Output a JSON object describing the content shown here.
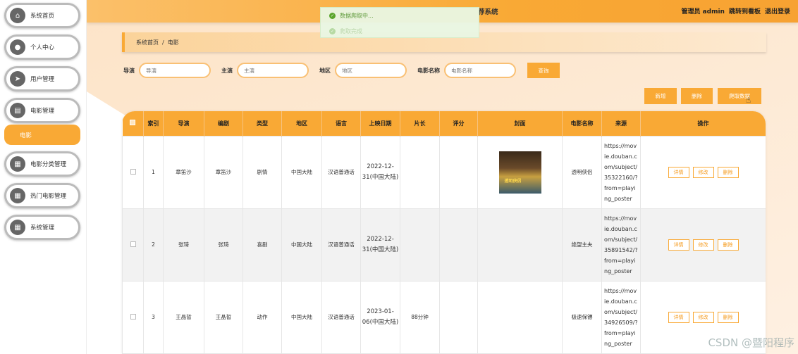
{
  "sidebar": {
    "items": [
      {
        "label": "系统首页",
        "icon": "home-icon"
      },
      {
        "label": "个人中心",
        "icon": "user-icon"
      },
      {
        "label": "用户管理",
        "icon": "send-icon"
      },
      {
        "label": "电影管理",
        "icon": "clipboard-icon"
      },
      {
        "label": "电影分类管理",
        "icon": "grid-icon"
      },
      {
        "label": "热门电影管理",
        "icon": "grid-icon"
      },
      {
        "label": "系统管理",
        "icon": "grid-icon"
      }
    ],
    "sub_item": {
      "label": "电影"
    }
  },
  "header": {
    "title_fragment": "荐系统",
    "admin": "管理员 admin",
    "goto_dashboard": "跳转到看板",
    "logout": "退出登录"
  },
  "toast": {
    "message": "数据爬取中...",
    "message2": "爬取完成"
  },
  "breadcrumb": {
    "home": "系统首页",
    "separator": "/",
    "current": "电影"
  },
  "search": {
    "director_label": "导演",
    "director_placeholder": "导演",
    "writer_label": "主演",
    "writer_placeholder": "主演",
    "region_label": "地区",
    "region_placeholder": "地区",
    "name_label": "电影名称",
    "name_placeholder": "电影名称",
    "query_button": "查询"
  },
  "actions": {
    "add": "新增",
    "delete": "删除",
    "fetch": "爬取数据"
  },
  "table": {
    "headers": [
      "索引",
      "导演",
      "编剧",
      "类型",
      "地区",
      "语言",
      "上映日期",
      "片长",
      "评分",
      "封面",
      "电影名称",
      "来源",
      "操作"
    ],
    "rows": [
      {
        "index": "1",
        "director": "章笛沙",
        "writer": "章笛沙",
        "genre": "剧情",
        "region": "中国大陆",
        "language": "汉语普通话",
        "date": "2022-12-31(中国大陆)",
        "duration": "",
        "rating": "",
        "name": "透明侠侣",
        "source": "https://movie.douban.com/subject/35322160/?from=playing_poster",
        "poster_text": "透明侠侣"
      },
      {
        "index": "2",
        "director": "张琦",
        "writer": "张琦",
        "genre": "喜剧",
        "region": "中国大陆",
        "language": "汉语普通话",
        "date": "2022-12-31(中国大陆)",
        "duration": "",
        "rating": "",
        "name": "绝望主夫",
        "source": "https://movie.douban.com/subject/35891542/?from=playing_poster",
        "poster_text": ""
      },
      {
        "index": "3",
        "director": "王晶晢",
        "writer": "王晶晢",
        "genre": "动作",
        "region": "中国大陆",
        "language": "汉语普通话",
        "date": "2023-01-06(中国大陆)",
        "duration": "88分钟",
        "rating": "",
        "name": "极速保镖",
        "source": "https://movie.douban.com/subject/34926509/?from=playing_poster",
        "poster_text": ""
      }
    ],
    "op_detail": "详情",
    "op_edit": "修改",
    "op_delete": "删除"
  },
  "watermark": "CSDN @暨阳程序",
  "colors": {
    "accent": "#f9a935",
    "toast_green": "#53a52b"
  }
}
